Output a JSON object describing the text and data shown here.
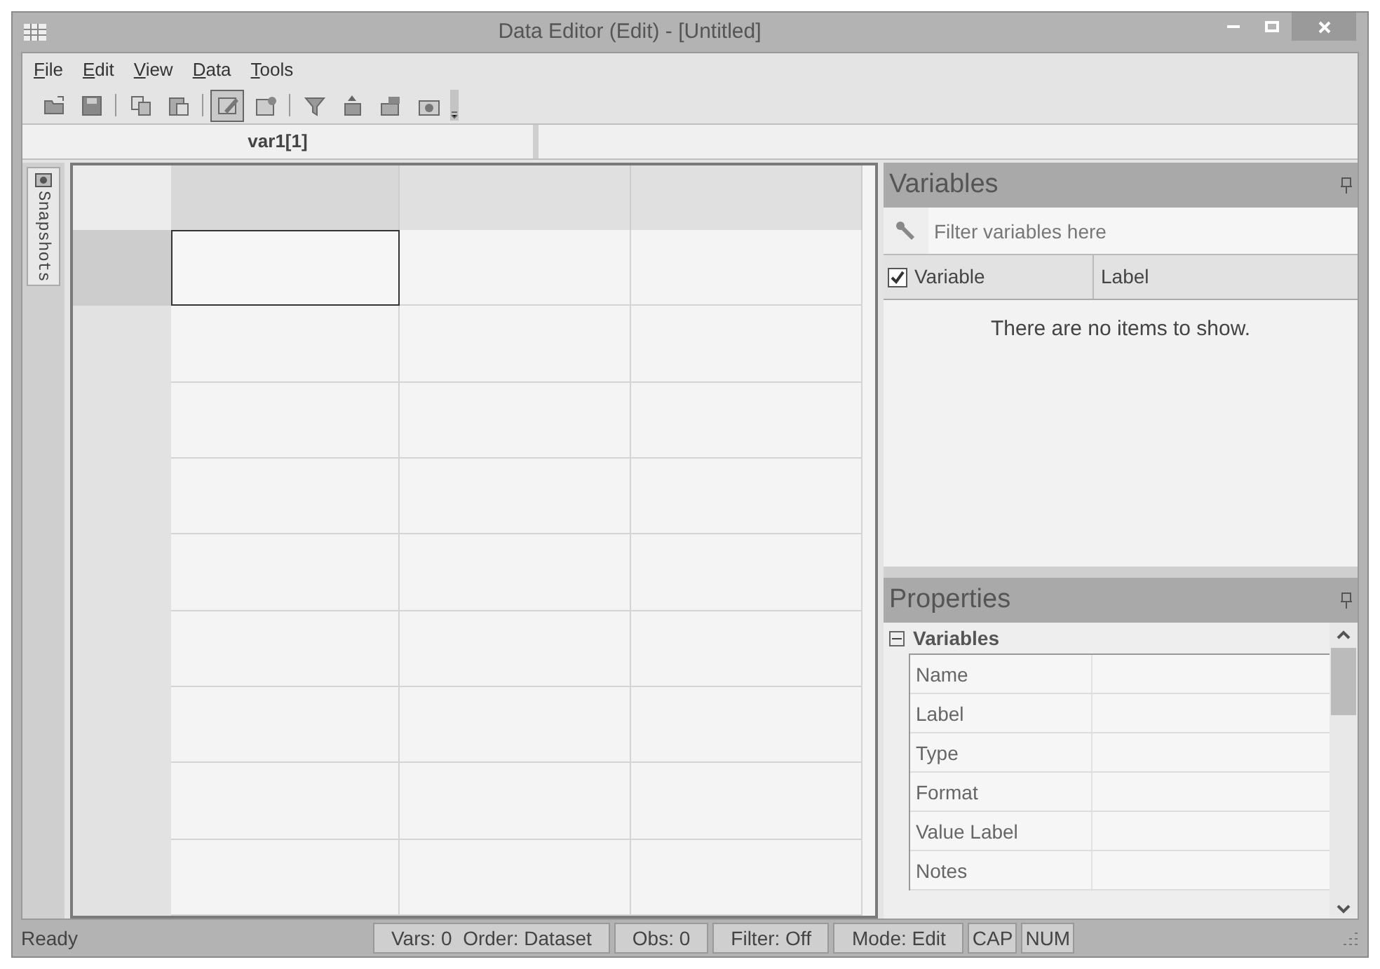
{
  "window": {
    "title": "Data Editor (Edit) - [Untitled]"
  },
  "menu": [
    {
      "label": "File"
    },
    {
      "label": "Edit"
    },
    {
      "label": "View"
    },
    {
      "label": "Data"
    },
    {
      "label": "Tools"
    }
  ],
  "toolbar": [
    {
      "kind": "open",
      "pressed": false
    },
    {
      "kind": "save",
      "pressed": false
    },
    {
      "kind": "separator"
    },
    {
      "kind": "copy",
      "pressed": false
    },
    {
      "kind": "paste",
      "pressed": false
    },
    {
      "kind": "separator"
    },
    {
      "kind": "edit",
      "pressed": true
    },
    {
      "kind": "browse",
      "pressed": false
    },
    {
      "kind": "separator"
    },
    {
      "kind": "filter",
      "pressed": false
    },
    {
      "kind": "variables",
      "pressed": false
    },
    {
      "kind": "properties",
      "pressed": false
    },
    {
      "kind": "snapshot",
      "pressed": false
    }
  ],
  "cell_name": "var1[1]",
  "side_tab": "Snapshots",
  "grid": {
    "rows": [
      {
        "cells": [
          {
            "selected": true
          },
          {
            "selected": false
          },
          {
            "selected": false
          }
        ]
      },
      {
        "cells": [
          {
            "selected": false
          },
          {
            "selected": false
          },
          {
            "selected": false
          }
        ]
      },
      {
        "cells": [
          {
            "selected": false
          },
          {
            "selected": false
          },
          {
            "selected": false
          }
        ]
      },
      {
        "cells": [
          {
            "selected": false
          },
          {
            "selected": false
          },
          {
            "selected": false
          }
        ]
      },
      {
        "cells": [
          {
            "selected": false
          },
          {
            "selected": false
          },
          {
            "selected": false
          }
        ]
      },
      {
        "cells": [
          {
            "selected": false
          },
          {
            "selected": false
          },
          {
            "selected": false
          }
        ]
      },
      {
        "cells": [
          {
            "selected": false
          },
          {
            "selected": false
          },
          {
            "selected": false
          }
        ]
      },
      {
        "cells": [
          {
            "selected": false
          },
          {
            "selected": false
          },
          {
            "selected": false
          }
        ]
      },
      {
        "cells": [
          {
            "selected": false
          },
          {
            "selected": false
          },
          {
            "selected": false
          }
        ]
      }
    ]
  },
  "variables_panel": {
    "title": "Variables",
    "filter": {
      "placeholder": "Filter variables here"
    },
    "columns": [
      {
        "label": "Variable",
        "checked": true
      },
      {
        "label": "Label"
      }
    ],
    "empty_message": "There are no items to show."
  },
  "properties_panel": {
    "title": "Properties",
    "group": {
      "label": "Variables",
      "expanded": true,
      "items": [
        "Name",
        "Label",
        "Type",
        "Format",
        "Value Label",
        "Notes"
      ]
    }
  },
  "status_bar": {
    "message": "Ready",
    "panes": [
      "Vars: 0  Order: Dataset",
      "Obs: 0",
      "Filter: Off",
      "Mode: Edit",
      "CAP",
      "NUM"
    ]
  }
}
